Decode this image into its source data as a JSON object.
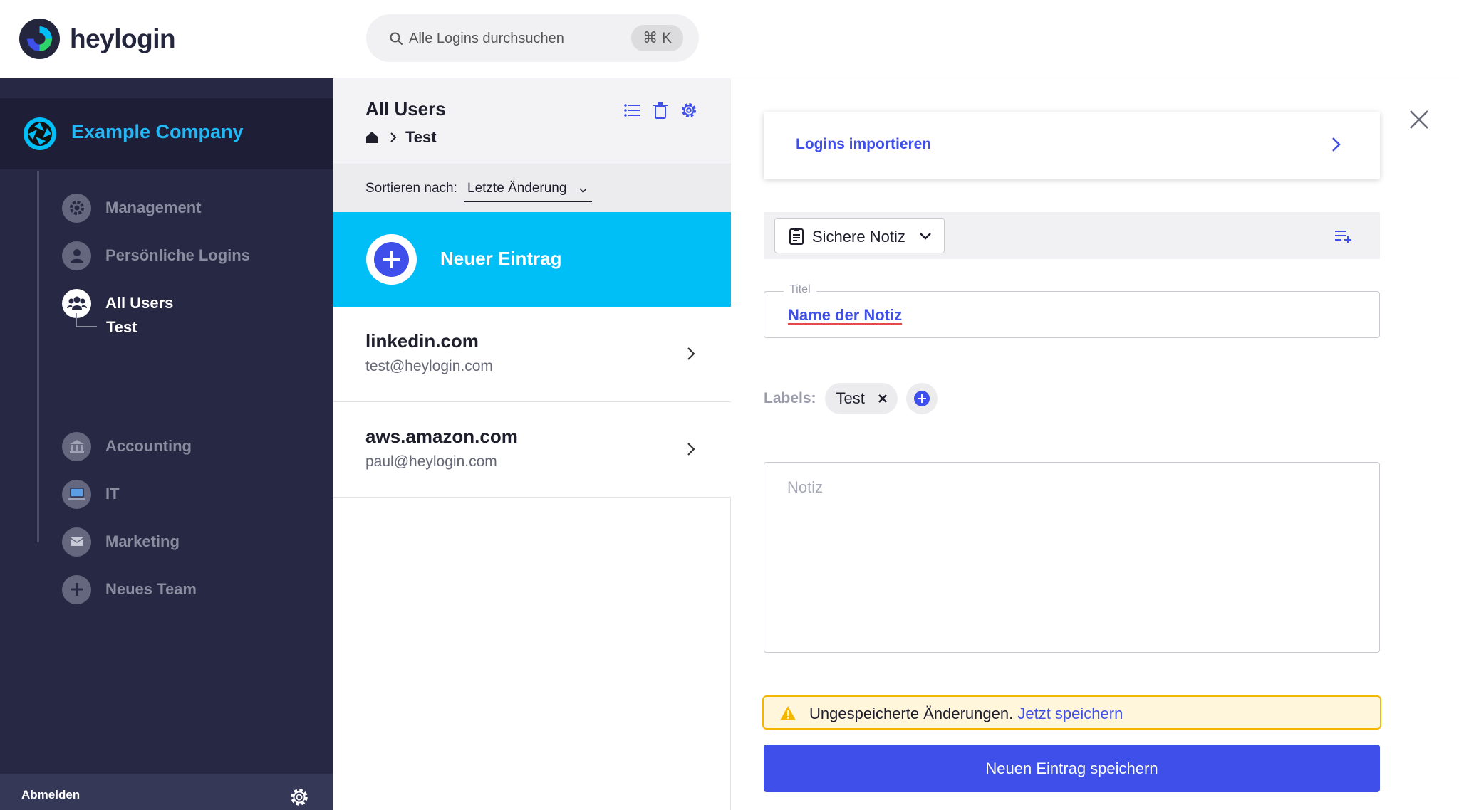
{
  "brand": {
    "name": "heylogin"
  },
  "search": {
    "placeholder": "Alle Logins durchsuchen",
    "shortcut": "⌘ K"
  },
  "sidebar": {
    "company": "Example Company",
    "items": [
      {
        "label": "Management",
        "icon": "gear-icon"
      },
      {
        "label": "Persönliche Logins",
        "icon": "person-icon"
      },
      {
        "label": "All Users",
        "icon": "users-icon"
      },
      {
        "label": "Accounting",
        "icon": "bank-icon"
      },
      {
        "label": "IT",
        "icon": "laptop-icon"
      },
      {
        "label": "Marketing",
        "icon": "mail-icon"
      },
      {
        "label": "Neues Team",
        "icon": "plus-icon"
      }
    ],
    "sub_item": "Test",
    "logout": "Abmelden"
  },
  "list": {
    "title": "All Users",
    "breadcrumb": "Test",
    "sort_label": "Sortieren nach:",
    "sort_value": "Letzte Änderung",
    "new_entry": "Neuer Eintrag",
    "entries": [
      {
        "title": "linkedin.com",
        "subtitle": "test@heylogin.com"
      },
      {
        "title": "aws.amazon.com",
        "subtitle": "paul@heylogin.com"
      }
    ]
  },
  "editor": {
    "import_label": "Logins importieren",
    "type_label": "Sichere Notiz",
    "title_legend": "Titel",
    "title_value": "Name der Notiz",
    "labels_title": "Labels:",
    "labels": [
      "Test"
    ],
    "note_placeholder": "Notiz",
    "warning_text": "Ungespeicherte Änderungen.",
    "warning_link": "Jetzt speichern",
    "save_button": "Neuen Eintrag speichern"
  },
  "colors": {
    "accent": "#3f4fe9",
    "cyan": "#00bef6",
    "sidebar_bg": "#272843",
    "warning": "#f5b600"
  }
}
